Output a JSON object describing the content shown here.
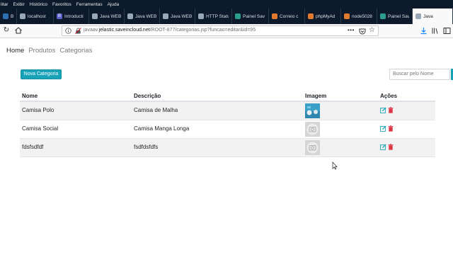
{
  "menubar": [
    "litar",
    "Exibir",
    "Histórico",
    "Favoritos",
    "Ferramentas",
    "Ajuda"
  ],
  "tabs": [
    {
      "label": "Ba",
      "fav_color": "#2f6fb0",
      "fav_glyph": ""
    },
    {
      "label": "localhost",
      "fav_color": "#9aa7b6",
      "fav_glyph": ""
    },
    {
      "label": "Introducti",
      "fav_color": "#5a5fc9",
      "fav_glyph": "B"
    },
    {
      "label": "Java WEB /",
      "fav_color": "#9aa7b6",
      "fav_glyph": ""
    },
    {
      "label": "Java WEB /",
      "fav_color": "#9aa7b6",
      "fav_glyph": ""
    },
    {
      "label": "Java WEB /",
      "fav_color": "#9aa7b6",
      "fav_glyph": ""
    },
    {
      "label": "HTTP Statu",
      "fav_color": "#9aa7b6",
      "fav_glyph": ""
    },
    {
      "label": "Painel Sav",
      "fav_color": "#2a9d8f",
      "fav_glyph": ""
    },
    {
      "label": "Correio c",
      "fav_color": "#e07a2e",
      "fav_glyph": ""
    },
    {
      "label": "phpMyAd",
      "fav_color": "#e07a2e",
      "fav_glyph": ""
    },
    {
      "label": "node5028",
      "fav_color": "#e07a2e",
      "fav_glyph": ""
    },
    {
      "label": "Painel Sav",
      "fav_color": "#2a9d8f",
      "fav_glyph": ""
    },
    {
      "label": "Java",
      "fav_color": "#9aa7b6",
      "fav_glyph": ""
    }
  ],
  "active_tab_index": 12,
  "url": {
    "prefix": "javaav.",
    "host": "jelastic.saveincloud.net",
    "path": "/ROOT-877/categorias.jsp?funcao=editar&id=95"
  },
  "site_nav": [
    "Home",
    "Produtos",
    "Categorias"
  ],
  "new_button_label": "Nova Categoria",
  "search_placeholder": "Buscar pelo Nome",
  "columns": [
    "Nome",
    "Descrição",
    "Imagem",
    "Ações"
  ],
  "rows": [
    {
      "nome": "Camisa Polo",
      "descricao": "Camisa de Malha",
      "image": "photo"
    },
    {
      "nome": "Camisa Social",
      "descricao": "Camisa Manga Longa",
      "image": "placeholder"
    },
    {
      "nome": "fdsfsdfdf",
      "descricao": "fsdfdsfdfs",
      "image": "placeholder"
    }
  ],
  "colors": {
    "accent": "#17a2b8",
    "edit": "#17a2b8",
    "delete": "#dc3545",
    "chrome": "#0d1a2b"
  },
  "icons": [
    "reload-icon",
    "home-icon",
    "info-icon",
    "lock-icon",
    "more-icon",
    "pocket-icon",
    "star-icon",
    "download-icon",
    "library-icon",
    "sidebar-icon",
    "edit-icon",
    "trash-icon",
    "image-placeholder-icon",
    "mouse-cursor-icon"
  ]
}
